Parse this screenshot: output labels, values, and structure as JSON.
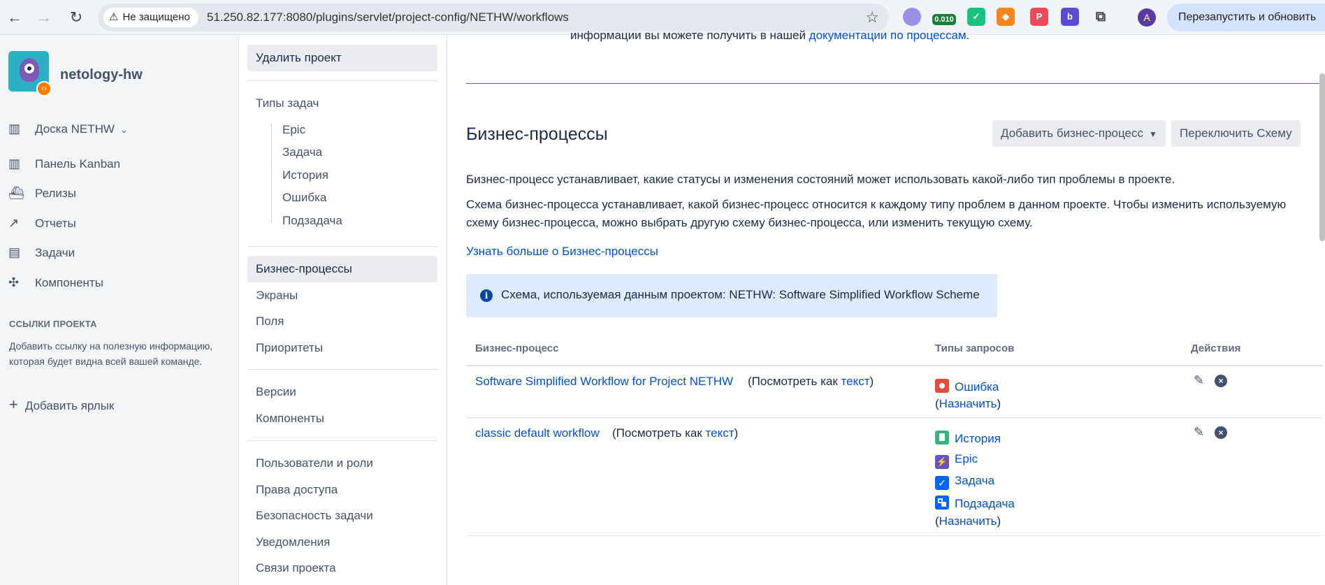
{
  "browser": {
    "security_chip": "Не защищено",
    "url": "51.250.82.177:8080/plugins/servlet/project-config/NETHW/workflows",
    "ext_badge": "0.010",
    "profile_initial": "A",
    "relaunch_label": "Перезапустить и обновить"
  },
  "sidebar": {
    "project_name": "netology-hw",
    "board_label": "Доска NETHW",
    "items": [
      {
        "label": "Панель Kanban",
        "icon": "kanban-icon"
      },
      {
        "label": "Релизы",
        "icon": "ship-icon"
      },
      {
        "label": "Отчеты",
        "icon": "chart-icon"
      },
      {
        "label": "Задачи",
        "icon": "issues-icon"
      },
      {
        "label": "Компоненты",
        "icon": "puzzle-icon"
      }
    ],
    "links_heading": "ССЫЛКИ ПРОЕКТА",
    "links_desc": "Добавить ссылку на полезную информацию, которая будет видна всей вашей команде.",
    "add_shortcut": "Добавить ярлык"
  },
  "settings_nav": {
    "delete_project": "Удалить проект",
    "issue_types_heading": "Типы задач",
    "issue_types": [
      "Epic",
      "Задача",
      "История",
      "Ошибка",
      "Подзадача"
    ],
    "group1": [
      "Бизнес-процессы",
      "Экраны",
      "Поля",
      "Приоритеты"
    ],
    "group2": [
      "Версии",
      "Компоненты"
    ],
    "group3": [
      "Пользователи и роли",
      "Права доступа",
      "Безопасность задачи",
      "Уведомления",
      "Связи проекта"
    ]
  },
  "main": {
    "cut_text_prefix": "информации вы можете получить в нашей ",
    "cut_text_link": "документации по процессам",
    "cut_text_suffix": ".",
    "title": "Бизнес-процессы",
    "add_button": "Добавить бизнес-процесс",
    "switch_button": "Переключить Схему",
    "desc1": "Бизнес-процесс устанавливает, какие статусы и изменения состояний может использовать какой-либо тип проблемы в проекте.",
    "desc2": "Схема бизнес-процесса устанавливает, какой бизнес-процесс относится к каждому типу проблем в данном проекте. Чтобы изменить используемую схему бизнес-процесса, можно выбрать другую схему бизнес-процесса, или изменить текущую схему.",
    "learn_more": "Узнать больше о Бизнес-процессы",
    "scheme_info": "Схема, используемая данным проектом: NETHW: Software Simplified Workflow Scheme",
    "table": {
      "headers": [
        "Бизнес-процесс",
        "Типы запросов",
        "Действия"
      ],
      "view_prefix": "(Посмотреть как ",
      "view_link": "текст",
      "view_suffix": ")",
      "assign_open": "(",
      "assign_link": "Назначить",
      "assign_close": ")",
      "rows": [
        {
          "name": "Software Simplified Workflow for Project NETHW",
          "types": [
            {
              "label": "Ошибка",
              "color": "#e5493a"
            }
          ]
        },
        {
          "name": "classic default workflow",
          "types": [
            {
              "label": "История",
              "color": "#36b37e"
            },
            {
              "label": "Epic",
              "color": "#6554c0"
            },
            {
              "label": "Задача",
              "color": "#0065ff"
            },
            {
              "label": "Подзадача",
              "color": "#0065ff"
            }
          ]
        }
      ]
    }
  },
  "colors": {
    "link": "#0052cc",
    "accent": "#6554c0",
    "info_bg": "#deebff"
  }
}
